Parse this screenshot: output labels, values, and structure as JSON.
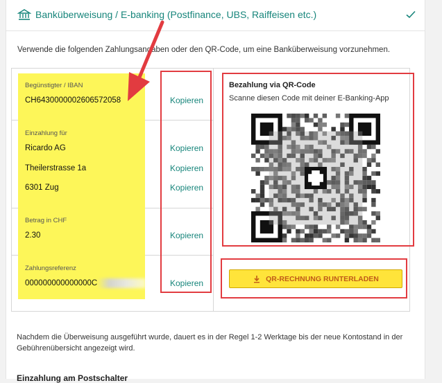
{
  "header": {
    "title": "Banküberweisung / E-banking (Postfinance, UBS, Raiffeisen etc.)",
    "icon": "bank-icon",
    "status_icon": "check-icon",
    "accent": "#17857b"
  },
  "intro": "Verwende die folgenden Zahlungsangaben oder den QR-Code, um eine Banküberweisung vorzunehmen.",
  "payment": {
    "beneficiary_label": "Begünstigter / IBAN",
    "iban": "CH6430000002606572058",
    "deposit_label": "Einzahlung für",
    "recipient_name": "Ricardo AG",
    "recipient_street": "Theilerstrasse 1a",
    "recipient_city": "6301 Zug",
    "amount_label": "Betrag in CHF",
    "amount": "2.30",
    "reference_label": "Zahlungsreferenz",
    "reference": "000000000000000C",
    "copy_label": "Kopieren"
  },
  "qr": {
    "title": "Bezahlung via QR-Code",
    "subtitle": "Scanne diesen Code mit deiner E-Banking-App",
    "download_label": "QR-RECHNUNG RUNTERLADEN",
    "download_icon": "download-icon"
  },
  "note": "Nachdem die Überweisung ausgeführt wurde, dauert es in der Regel 1-2 Werktage bis der neue Kontostand in der Gebührenübersicht angezeigt wird.",
  "next_section_title": "Einzahlung am Postschalter",
  "colors": {
    "highlight": "#fdf659",
    "annotation_red": "#e23b40",
    "button_yellow": "#ffe43a",
    "button_text": "#c05b18"
  }
}
